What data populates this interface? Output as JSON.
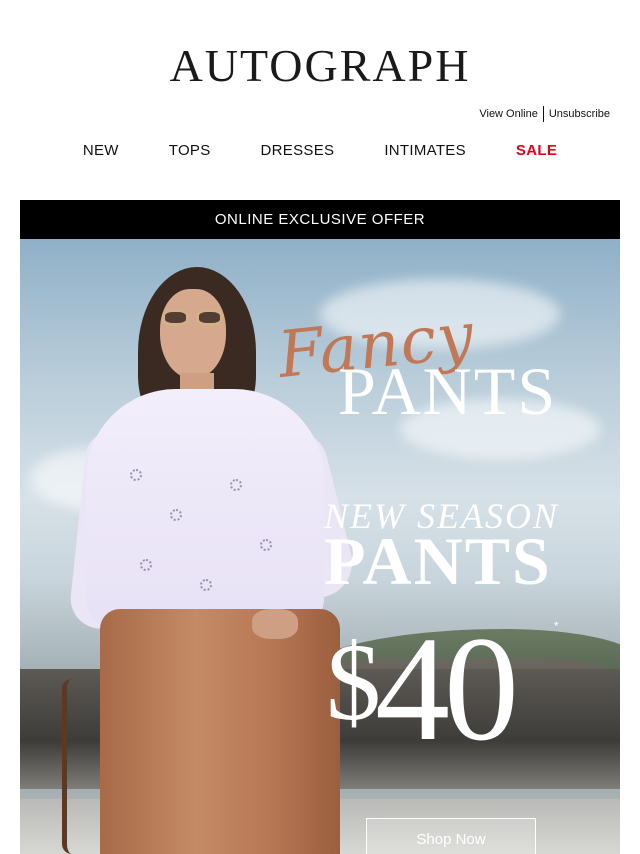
{
  "header": {
    "logo": "AUTOGRAPH",
    "utility": {
      "view_online": "View Online",
      "unsubscribe": "Unsubscribe"
    }
  },
  "nav": {
    "items": [
      {
        "label": "NEW"
      },
      {
        "label": "TOPS"
      },
      {
        "label": "DRESSES"
      },
      {
        "label": "INTIMATES"
      },
      {
        "label": "SALE"
      }
    ]
  },
  "hero": {
    "banner": "ONLINE EXCLUSIVE OFFER",
    "script_title": "Fancy",
    "title": "PANTS",
    "subtitle": "NEW SEASON",
    "subtitle_title": "PANTS",
    "price_currency": "$",
    "price_value": "40",
    "price_note": "*",
    "cta": "Shop Now"
  },
  "colors": {
    "sale": "#e2001a",
    "banner_bg": "#000000",
    "fancy_script": "#c07856"
  }
}
